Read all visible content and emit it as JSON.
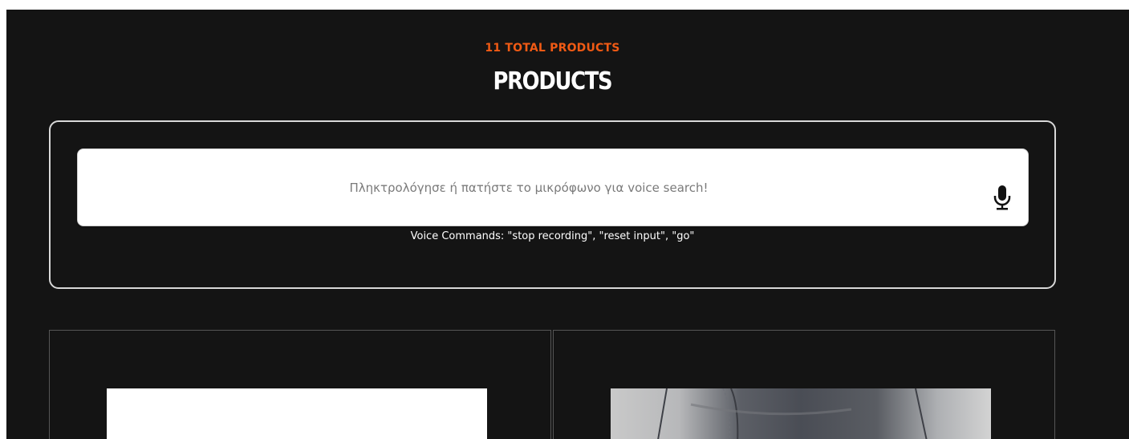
{
  "header": {
    "total_products": "11 TOTAL PRODUCTS",
    "title": "PRODUCTS"
  },
  "search": {
    "placeholder": "Πληκτρολόγησε ή πατήστε το μικρόφωνο για voice search!",
    "value": "",
    "mic_icon": "microphone-icon",
    "voice_commands": "Voice Commands: \"stop recording\", \"reset input\", \"go\""
  },
  "colors": {
    "accent": "#f05a14",
    "background": "#141414",
    "text": "#ffffff"
  },
  "products": [
    {
      "image": "white-product-image"
    },
    {
      "image": "jeans-product-image"
    }
  ]
}
